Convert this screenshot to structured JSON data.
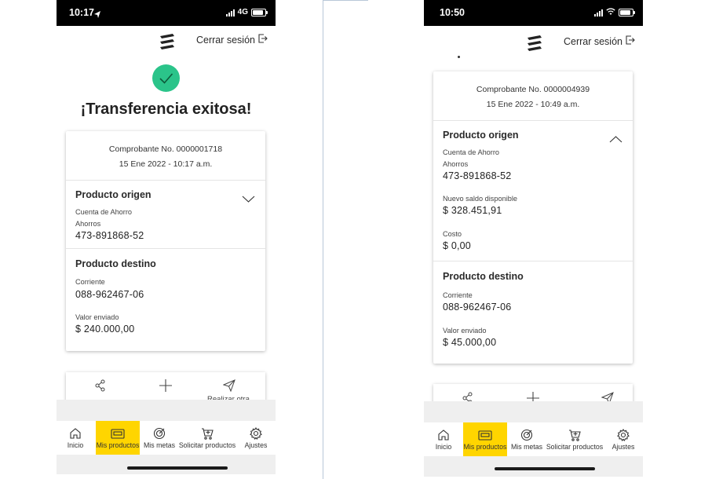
{
  "phone1": {
    "status": {
      "time": "10:17",
      "network": "4G"
    },
    "logout_label": "Cerrar sesión",
    "title": "¡Transferencia exitosa!",
    "receipt": {
      "number": "Comprobante No. 0000001718",
      "date": "15 Ene 2022 - 10:17 a.m."
    },
    "origin": {
      "title": "Producto origen",
      "account_type": "Cuenta de Ahorro",
      "account_subtype": "Ahorros",
      "account_number": "473-891868-52"
    },
    "destination": {
      "title": "Producto destino",
      "type_label": "Corriente",
      "account_number": "088-962467-06",
      "amount_label": "Valor enviado",
      "amount": "$ 240.000,00"
    },
    "actions": {
      "third_label": "Realizar otra"
    }
  },
  "phone2": {
    "status": {
      "time": "10:50"
    },
    "logout_label": "Cerrar sesión",
    "receipt": {
      "number": "Comprobante No. 0000004939",
      "date": "15 Ene 2022 - 10:49 a.m."
    },
    "origin": {
      "title": "Producto origen",
      "account_type": "Cuenta de Ahorro",
      "account_subtype": "Ahorros",
      "account_number": "473-891868-52",
      "balance_label": "Nuevo saldo disponible",
      "balance": "$ 328.451,91",
      "cost_label": "Costo",
      "cost": "$ 0,00"
    },
    "destination": {
      "title": "Producto destino",
      "type_label": "Corriente",
      "account_number": "088-962467-06",
      "amount_label": "Valor enviado",
      "amount": "$ 45.000,00"
    }
  },
  "tabs": [
    {
      "label": "Inicio",
      "icon": "home-icon"
    },
    {
      "label": "Mis productos",
      "icon": "wallet-icon",
      "active": true
    },
    {
      "label": "Mis metas",
      "icon": "target-icon"
    },
    {
      "label": "Solicitar productos",
      "icon": "cart-icon"
    },
    {
      "label": "Ajustes",
      "icon": "gear-icon"
    }
  ],
  "colors": {
    "accent_yellow": "#ffd500",
    "success_green": "#2bc48a",
    "status_bar": "#000000"
  }
}
